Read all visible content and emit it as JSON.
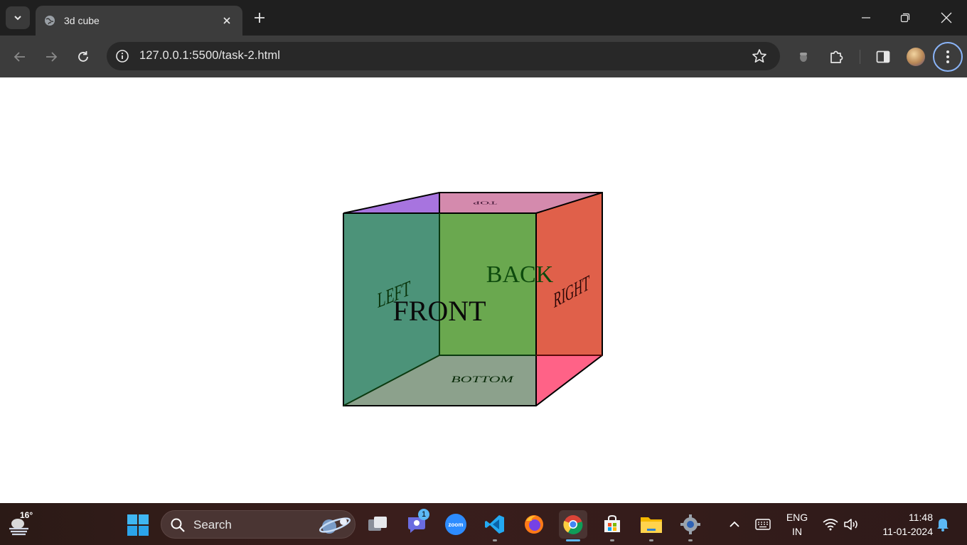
{
  "browser": {
    "tab_title": "3d cube",
    "url": "127.0.0.1:5500/task-2.html"
  },
  "cube": {
    "labels": {
      "front": "FRONT",
      "back": "BACK",
      "left": "LEFT",
      "right": "RIGHT",
      "top": "TOP",
      "bottom": "BOTTOM"
    },
    "colors": {
      "front": "#3aa17a",
      "back": "#6aa84f",
      "left": "#4c9379",
      "right": "#e0604a",
      "top_left": "#a774df",
      "top_right": "#d48aad",
      "bottom": "#8ca18c",
      "bottom_right": "#ff6287"
    }
  },
  "taskbar": {
    "weather_temp": "16°",
    "search_placeholder": "Search",
    "teams_badge": "1",
    "zoom_text": "zoom",
    "language_line1": "ENG",
    "language_line2": "IN",
    "time": "11:48",
    "date": "11-01-2024"
  }
}
